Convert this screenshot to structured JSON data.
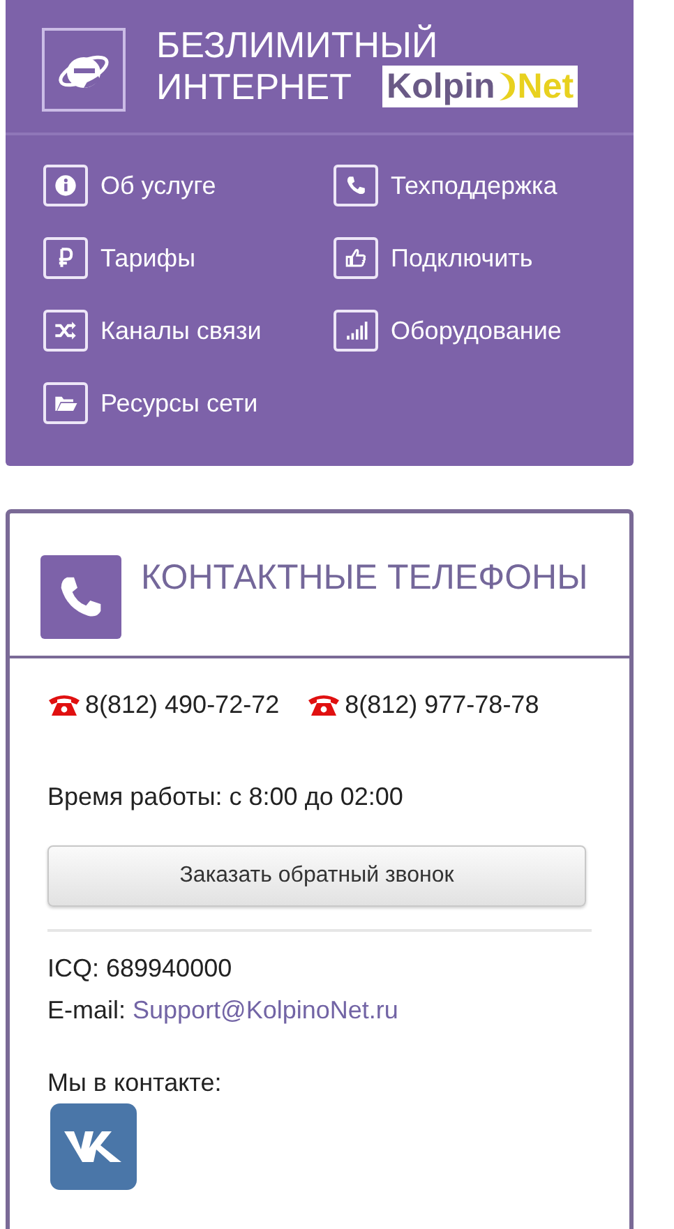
{
  "banner": {
    "title_line_1": "БЕЗЛИМИТНЫЙ",
    "title_line_2": "ИНТЕРНЕТ",
    "logo": {
      "part_1": "Kolpin",
      "part_2": "Net"
    }
  },
  "menu": [
    {
      "label": "Об услуге"
    },
    {
      "label": "Техподдержка"
    },
    {
      "label": "Тарифы"
    },
    {
      "label": "Подключить"
    },
    {
      "label": "Каналы связи"
    },
    {
      "label": "Оборудование"
    },
    {
      "label": "Ресурсы сети"
    }
  ],
  "contacts": {
    "title": "КОНТАКТНЫЕ ТЕЛЕФОНЫ",
    "phones": [
      "8(812) 490-72-72",
      "8(812) 977-78-78"
    ],
    "hours": "Время работы: с 8:00 до 02:00",
    "callback_button": "Заказать обратный звонок",
    "icq": "ICQ: 689940000",
    "email_label": "E-mail:",
    "email": "Support@KolpinoNet.ru",
    "social_label": "Мы в контакте:"
  }
}
